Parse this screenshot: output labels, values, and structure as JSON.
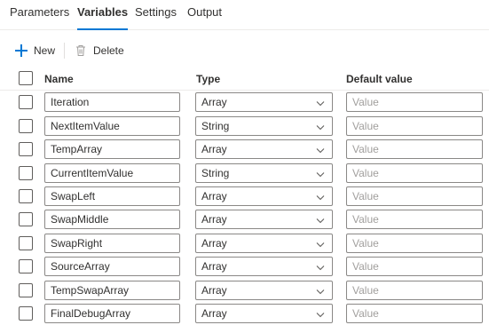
{
  "tabs": [
    {
      "label": "Parameters",
      "active": false
    },
    {
      "label": "Variables",
      "active": true
    },
    {
      "label": "Settings",
      "active": false
    },
    {
      "label": "Output",
      "active": false
    }
  ],
  "toolbar": {
    "new_label": "New",
    "delete_label": "Delete"
  },
  "columns": {
    "name": "Name",
    "type": "Type",
    "default": "Default value"
  },
  "placeholder": "Value",
  "accent_color": "#0078d4",
  "rows": [
    {
      "name": "Iteration",
      "type": "Array"
    },
    {
      "name": "NextItemValue",
      "type": "String"
    },
    {
      "name": "TempArray",
      "type": "Array"
    },
    {
      "name": "CurrentItemValue",
      "type": "String"
    },
    {
      "name": "SwapLeft",
      "type": "Array"
    },
    {
      "name": "SwapMiddle",
      "type": "Array"
    },
    {
      "name": "SwapRight",
      "type": "Array"
    },
    {
      "name": "SourceArray",
      "type": "Array"
    },
    {
      "name": "TempSwapArray",
      "type": "Array"
    },
    {
      "name": "FinalDebugArray",
      "type": "Array"
    }
  ]
}
